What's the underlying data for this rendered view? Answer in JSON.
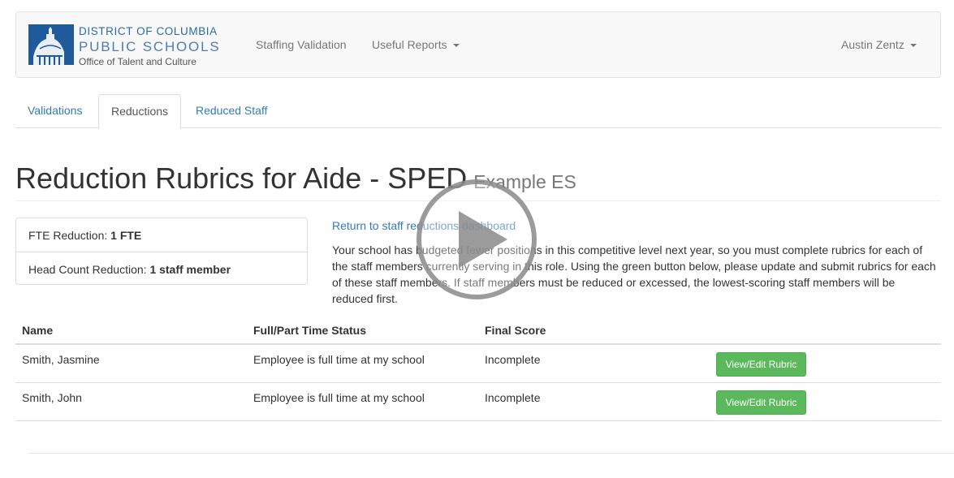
{
  "brand": {
    "line1": "DISTRICT OF COLUMBIA",
    "line2": "PUBLIC SCHOOLS",
    "line3": "Office of Talent and Culture"
  },
  "nav": {
    "staffing_validation": "Staffing Validation",
    "useful_reports": "Useful Reports",
    "user": "Austin Zentz"
  },
  "tabs": [
    {
      "label": "Validations",
      "active": false
    },
    {
      "label": "Reductions",
      "active": true
    },
    {
      "label": "Reduced Staff",
      "active": false
    }
  ],
  "page": {
    "title": "Reduction Rubrics for Aide - SPED",
    "subtitle": "Example ES"
  },
  "summary": {
    "fte_label": "FTE Reduction:",
    "fte_value": "1 FTE",
    "headcount_label": "Head Count Reduction:",
    "headcount_value": "1 staff member"
  },
  "info": {
    "return_link": "Return to staff reductions dashboard",
    "description": "Your school has budgeted fewer positions in this competitive level next year, so you must complete rubrics for each of the staff members currently serving in this role. Using the green button below, please update and submit rubrics for each of these staff members. If staff members must be reduced or excessed, the lowest-scoring staff members will be reduced first."
  },
  "table": {
    "headers": [
      "Name",
      "Full/Part Time Status",
      "Final Score"
    ],
    "rows": [
      {
        "name": "Smith, Jasmine",
        "status": "Employee is full time at my school",
        "score": "Incomplete",
        "action": "View/Edit Rubric"
      },
      {
        "name": "Smith, John",
        "status": "Employee is full time at my school",
        "score": "Incomplete",
        "action": "View/Edit Rubric"
      }
    ]
  },
  "colors": {
    "link": "#337ab7",
    "success": "#5cb85c",
    "brand_blue": "#1f5a9a"
  },
  "icons": {
    "logo": "capitol-dome-icon",
    "overlay": "play-icon"
  }
}
